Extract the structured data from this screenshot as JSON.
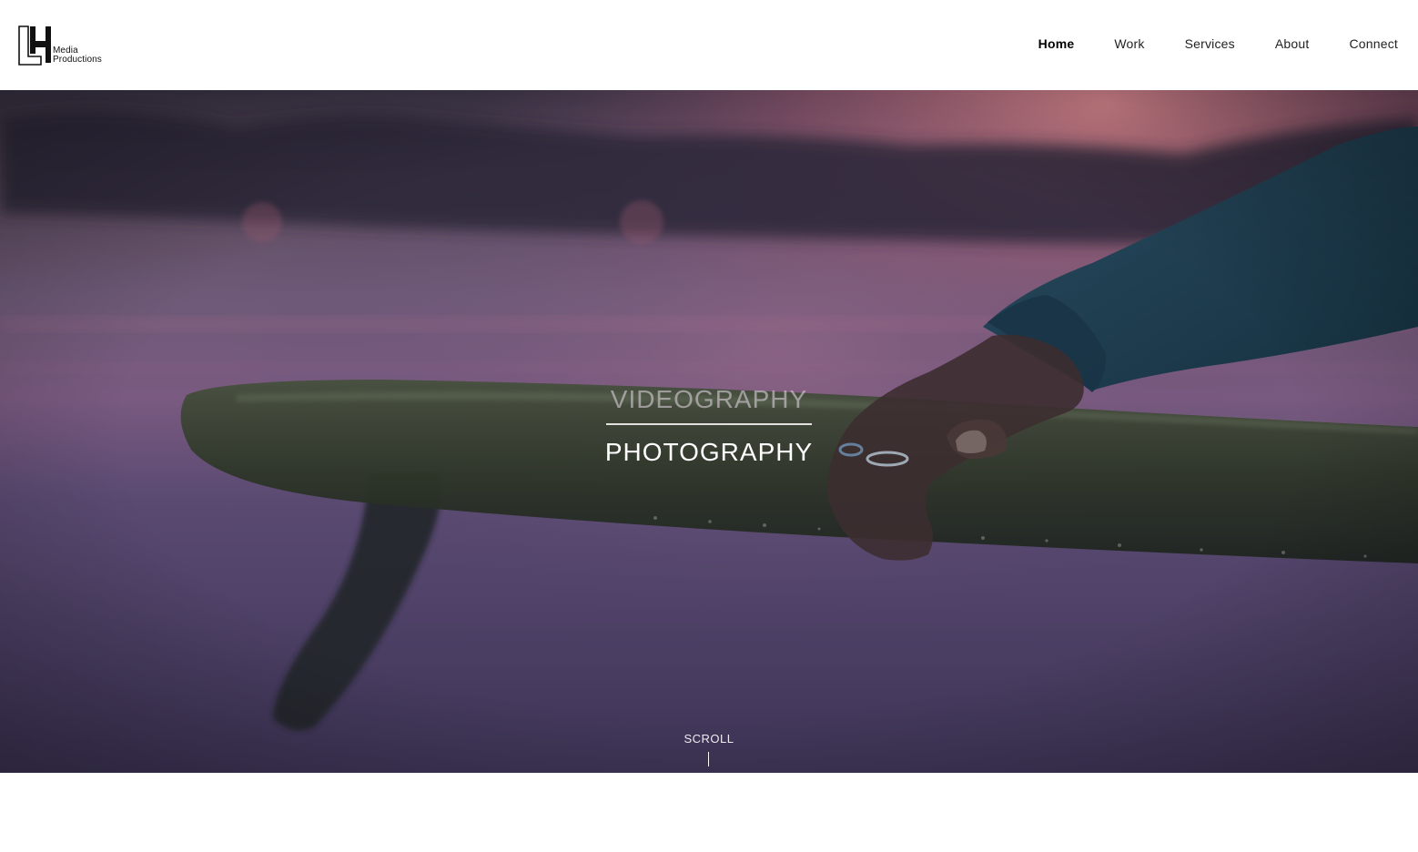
{
  "header": {
    "logo": {
      "monogram": "LH",
      "line1": "Media",
      "line2": "Productions"
    },
    "nav": [
      {
        "label": "Home",
        "active": true
      },
      {
        "label": "Work",
        "active": false
      },
      {
        "label": "Services",
        "active": false
      },
      {
        "label": "About",
        "active": false
      },
      {
        "label": "Connect",
        "active": false
      }
    ]
  },
  "hero": {
    "title_primary": "VIDEOGRAPHY",
    "title_secondary": "PHOTOGRAPHY",
    "scroll_label": "SCROLL"
  },
  "colors": {
    "sky_top": "#3c3448",
    "sunset_pink": "#b0607a",
    "water": "#5a4a72",
    "board": "#2d3328",
    "wetsuit": "#1d3d52"
  }
}
